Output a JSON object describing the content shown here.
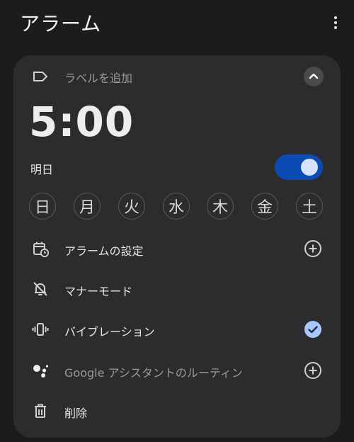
{
  "header": {
    "title": "アラーム"
  },
  "alarm": {
    "label_placeholder": "ラベルを追加",
    "time": "5:00",
    "schedule": "明日",
    "enabled": true,
    "days": [
      "日",
      "月",
      "火",
      "水",
      "木",
      "金",
      "土"
    ]
  },
  "options": [
    {
      "label": "アラームの設定",
      "icon": "calendar-clock-icon",
      "action": "add-circle-icon"
    },
    {
      "label": "マナーモード",
      "icon": "bell-off-icon",
      "action": ""
    },
    {
      "label": "バイブレーション",
      "icon": "vibration-icon",
      "action": "check-circle-icon"
    },
    {
      "label": "Google アシスタントのルーティン",
      "icon": "google-assistant-icon",
      "action": "add-circle-icon"
    },
    {
      "label": "削除",
      "icon": "trash-icon",
      "action": ""
    }
  ],
  "colors": {
    "accent": "#0b4bb3",
    "check": "#a8c7fa",
    "card": "#2c2c2e",
    "background": "#1c1c1e"
  }
}
